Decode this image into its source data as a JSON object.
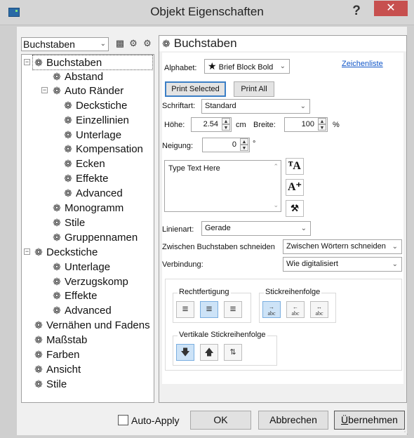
{
  "window": {
    "title": "Objekt Eigenschaften",
    "help": "?",
    "close": "✕"
  },
  "toolbar": {
    "combo_value": "Buchstaben",
    "icons": [
      "save-icon",
      "gear-pair-icon",
      "gear-tree-icon"
    ]
  },
  "tree": {
    "items": [
      {
        "label": "Buchstaben",
        "level": 0
      },
      {
        "label": "Abstand",
        "level": 1
      },
      {
        "label": "Auto Ränder",
        "level": 1
      },
      {
        "label": "Deckstiche",
        "level": 2
      },
      {
        "label": "Einzellinien",
        "level": 2
      },
      {
        "label": "Unterlage",
        "level": 2
      },
      {
        "label": "Kompensation",
        "level": 2
      },
      {
        "label": "Ecken",
        "level": 2
      },
      {
        "label": "Effekte",
        "level": 2
      },
      {
        "label": "Advanced",
        "level": 2
      },
      {
        "label": "Monogramm",
        "level": 1
      },
      {
        "label": "Stile",
        "level": 1
      },
      {
        "label": "Gruppennamen",
        "level": 1
      },
      {
        "label": "Deckstiche",
        "level": 0
      },
      {
        "label": "Unterlage",
        "level": 1
      },
      {
        "label": "Verzugskomp",
        "level": 1
      },
      {
        "label": "Effekte",
        "level": 1
      },
      {
        "label": "Advanced",
        "level": 1
      },
      {
        "label": "Vernähen und Fadens",
        "level": 0
      },
      {
        "label": "Maßstab",
        "level": 0
      },
      {
        "label": "Farben",
        "level": 0
      },
      {
        "label": "Ansicht",
        "level": 0
      },
      {
        "label": "Stile",
        "level": 0
      }
    ]
  },
  "panel": {
    "header": "Buchstaben",
    "alphabet_label": "Alphabet:",
    "alphabet_value": "Brief Block Bold",
    "zeichenliste": "Zeichenliste",
    "print_selected": "Print Selected",
    "print_all": "Print All",
    "schriftart_label": "Schriftart:",
    "schriftart_value": "Standard",
    "hoehe_label": "Höhe:",
    "hoehe_value": "2.54",
    "hoehe_unit": "cm",
    "breite_label": "Breite:",
    "breite_value": "100",
    "breite_unit": "%",
    "neigung_label": "Neigung:",
    "neigung_value": "0",
    "neigung_unit": "°",
    "text_value": "Type Text Here",
    "linienart_label": "Linienart:",
    "linienart_value": "Gerade",
    "zwischen_label": "Zwischen Buchstaben schneiden",
    "zwischen_value": "Zwischen Wörtern schneiden",
    "verbindung_label": "Verbindung:",
    "verbindung_value": "Wie digitalisiert",
    "rechtfertigung": "Rechtfertigung",
    "stickreihenfolge": "Stickreihenfolge",
    "vertikale": "Vertikale Stickreihenfolge"
  },
  "bottom": {
    "auto_apply": "Auto-Apply",
    "ok": "OK",
    "abbrechen": "Abbrechen",
    "uebernehmen_u": "Ü",
    "uebernehmen_rest": "bernehmen"
  }
}
